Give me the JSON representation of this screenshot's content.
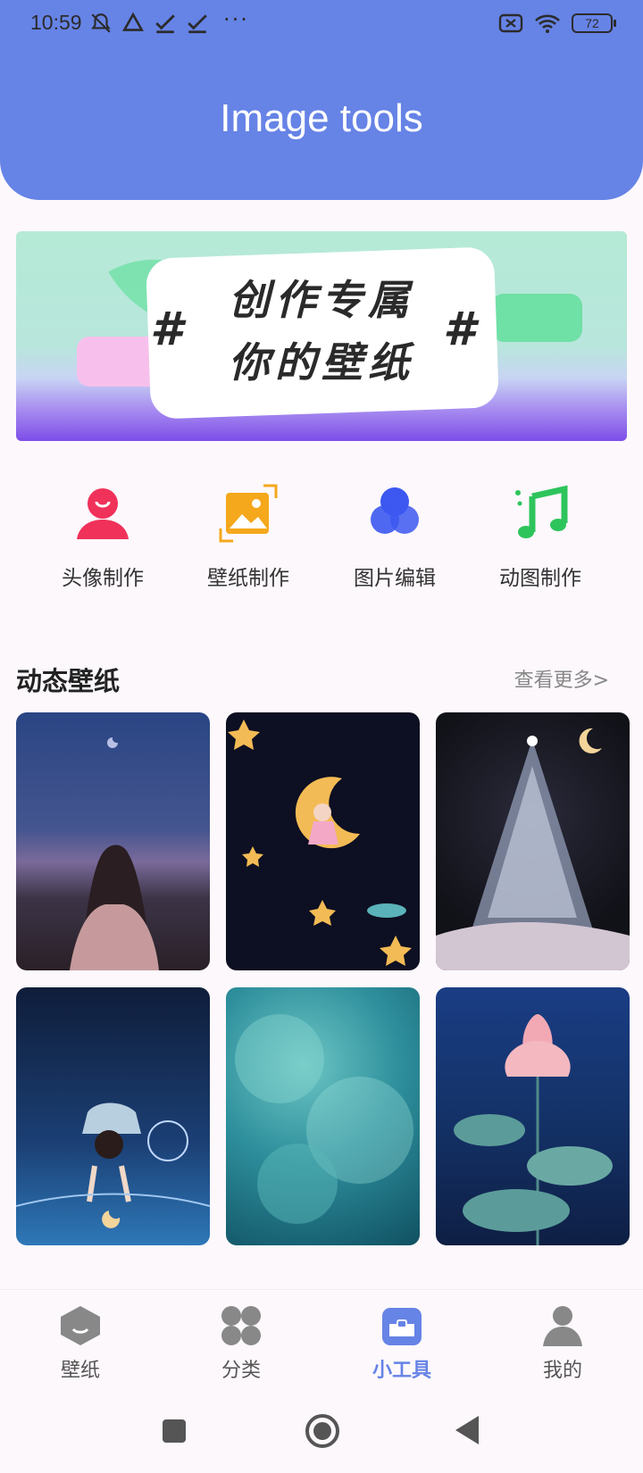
{
  "status_bar": {
    "time": "10:59",
    "battery": "72",
    "dots": "···"
  },
  "header": {
    "title": "Image tools"
  },
  "banner": {
    "line1": "创作专属",
    "line2": "你的壁纸",
    "hash": "#"
  },
  "tools": [
    {
      "label": "头像制作",
      "icon": "avatar-icon",
      "color": "#f0325a"
    },
    {
      "label": "壁纸制作",
      "icon": "image-icon",
      "color": "#f5a81c"
    },
    {
      "label": "图片编辑",
      "icon": "color-circles-icon",
      "color": "#3c58f0"
    },
    {
      "label": "动图制作",
      "icon": "music-note-icon",
      "color": "#2ec45c"
    }
  ],
  "section": {
    "title": "动态壁纸",
    "more": "查看更多>"
  },
  "tabs": [
    {
      "label": "壁纸",
      "icon": "wallpaper-icon"
    },
    {
      "label": "分类",
      "icon": "category-icon"
    },
    {
      "label": "小工具",
      "icon": "toolbox-icon",
      "active": true
    },
    {
      "label": "我的",
      "icon": "profile-icon"
    }
  ],
  "colors": {
    "accent": "#6683e6",
    "background": "#fcf8fc"
  }
}
